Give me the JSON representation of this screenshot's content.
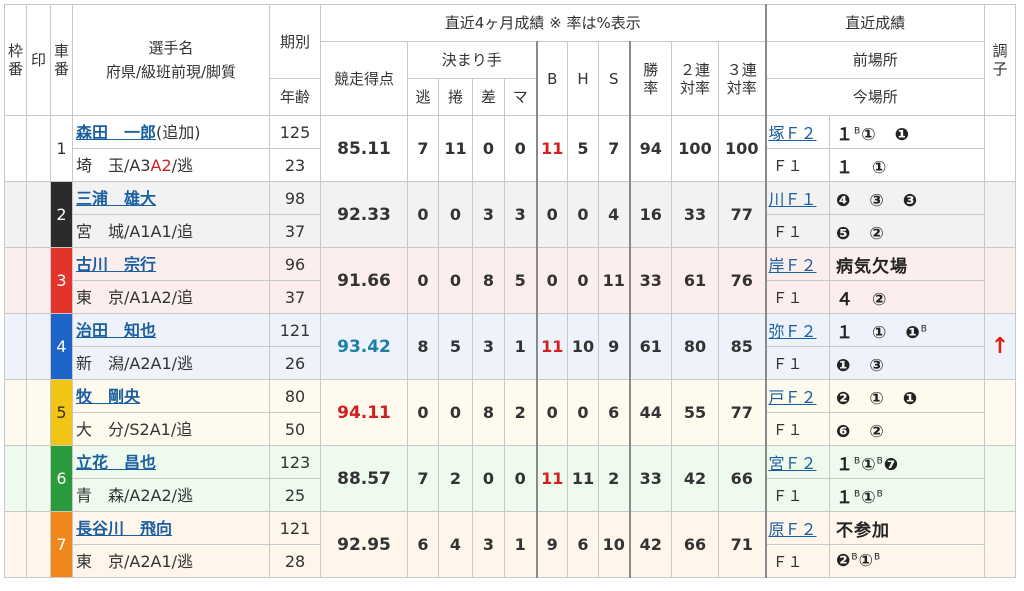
{
  "header": {
    "waku": "枠番",
    "shirushi": "印",
    "shaban": "車番",
    "name_label": "選手名",
    "pref_label": "府県/級班前現/脚質",
    "period_label": "期別",
    "age_label": "年齢",
    "recent4": "直近4ヶ月成績 ※ 率は%表示",
    "score_label": "競走得点",
    "kimari": "決まり手",
    "nige": "逃",
    "makuri": "捲",
    "sashi": "差",
    "mark": "マ",
    "b": "B",
    "h": "H",
    "s": "S",
    "win_label": "勝率",
    "ren2_label": "２連対率",
    "ren3_label": "３連対率",
    "recent_title": "直近成績",
    "prev_venue": "前場所",
    "cur_venue": "今場所",
    "condition": "調子"
  },
  "colors": {
    "frame1": "#ffffff",
    "frame2": "#2b2b2b",
    "frame3": "#e3342c",
    "frame4": "#1e63c8",
    "frame5": "#f2c515",
    "frame6": "#2b9a3c",
    "frame7": "#f0871c",
    "accent_red": "#d02020",
    "link_blue": "#1a5fa0"
  },
  "riders": [
    {
      "car": "1",
      "name": "森田　一郎",
      "note": "(追加)",
      "pref": "埼　玉/A3",
      "rank_cur": "A2",
      "style": "/逃",
      "period": "125",
      "age": "23",
      "score": "85.11",
      "nige": "7",
      "makuri": "11",
      "sashi": "0",
      "mark": "0",
      "b": "11",
      "h": "5",
      "s": "7",
      "win": "94",
      "ren2": "100",
      "ren3": "100",
      "prev_venue": "塚Ｆ２",
      "prev_res": "１",
      "prev_sup": "B",
      "prev_res2": "①　❶",
      "cur_venue": "Ｆ１",
      "cur_res": "１　①",
      "cur_sup": "",
      "cur_res2": "",
      "condition": ""
    },
    {
      "car": "2",
      "name": "三浦　雄大",
      "note": "",
      "pref": "宮　城/A1A1",
      "rank_cur": "",
      "style": "/追",
      "period": "98",
      "age": "37",
      "score": "92.33",
      "nige": "0",
      "makuri": "0",
      "sashi": "3",
      "mark": "3",
      "b": "0",
      "h": "0",
      "s": "4",
      "win": "16",
      "ren2": "33",
      "ren3": "77",
      "prev_venue": "川Ｆ１",
      "prev_res": "❹　③　❸",
      "prev_sup": "",
      "prev_res2": "",
      "cur_venue": "Ｆ１",
      "cur_res": "❺　②",
      "cur_sup": "",
      "cur_res2": "",
      "condition": ""
    },
    {
      "car": "3",
      "name": "古川　宗行",
      "note": "",
      "pref": "東　京/A1A2",
      "rank_cur": "",
      "style": "/追",
      "period": "96",
      "age": "37",
      "score": "91.66",
      "nige": "0",
      "makuri": "0",
      "sashi": "8",
      "mark": "5",
      "b": "0",
      "h": "0",
      "s": "11",
      "win": "33",
      "ren2": "61",
      "ren3": "76",
      "prev_venue": "岸Ｆ２",
      "prev_res": "病気欠場",
      "prev_sup": "",
      "prev_res2": "",
      "cur_venue": "Ｆ１",
      "cur_res": "４　②",
      "cur_sup": "",
      "cur_res2": "",
      "condition": ""
    },
    {
      "car": "4",
      "name": "治田　知也",
      "note": "",
      "pref": "新　潟/A2A1",
      "rank_cur": "",
      "style": "/逃",
      "period": "121",
      "age": "26",
      "score": "93.42",
      "nige": "8",
      "makuri": "5",
      "sashi": "3",
      "mark": "1",
      "b": "11",
      "h": "10",
      "s": "9",
      "win": "61",
      "ren2": "80",
      "ren3": "85",
      "prev_venue": "弥Ｆ２",
      "prev_res": "１　①　❶",
      "prev_sup": "B",
      "prev_res2": "",
      "cur_venue": "Ｆ１",
      "cur_res": "❶　③",
      "cur_sup": "",
      "cur_res2": "",
      "condition": "↑"
    },
    {
      "car": "5",
      "name": "牧　剛央",
      "note": "",
      "pref": "大　分/S2A1",
      "rank_cur": "",
      "style": "/追",
      "period": "80",
      "age": "50",
      "score": "94.11",
      "nige": "0",
      "makuri": "0",
      "sashi": "8",
      "mark": "2",
      "b": "0",
      "h": "0",
      "s": "6",
      "win": "44",
      "ren2": "55",
      "ren3": "77",
      "prev_venue": "戸Ｆ２",
      "prev_res": "❷　①　❶",
      "prev_sup": "",
      "prev_res2": "",
      "cur_venue": "Ｆ１",
      "cur_res": "❻　②",
      "cur_sup": "",
      "cur_res2": "",
      "condition": ""
    },
    {
      "car": "6",
      "name": "立花　昌也",
      "note": "",
      "pref": "青　森/A2A2",
      "rank_cur": "",
      "style": "/逃",
      "period": "123",
      "age": "25",
      "score": "88.57",
      "nige": "7",
      "makuri": "2",
      "sashi": "0",
      "mark": "0",
      "b": "11",
      "h": "11",
      "s": "2",
      "win": "33",
      "ren2": "42",
      "ren3": "66",
      "prev_venue": "宮Ｆ２",
      "prev_res": "１",
      "prev_sup": "B",
      "prev_res2": "①",
      "prev_sup2": "B",
      "prev_res3": "❼",
      "cur_venue": "Ｆ１",
      "cur_res": "１",
      "cur_sup": "B",
      "cur_res2": "①",
      "cur_sup2": "B",
      "condition": ""
    },
    {
      "car": "7",
      "name": "長谷川　飛向",
      "note": "",
      "pref": "東　京/A2A1",
      "rank_cur": "",
      "style": "/逃",
      "period": "121",
      "age": "28",
      "score": "92.95",
      "nige": "6",
      "makuri": "4",
      "sashi": "3",
      "mark": "1",
      "b": "9",
      "h": "6",
      "s": "10",
      "win": "42",
      "ren2": "66",
      "ren3": "71",
      "prev_venue": "原Ｆ２",
      "prev_res": "不参加",
      "prev_sup": "",
      "prev_res2": "",
      "cur_venue": "Ｆ１",
      "cur_res": "❷",
      "cur_sup": "B",
      "cur_res2": "①",
      "cur_sup2": "B",
      "condition": ""
    }
  ]
}
